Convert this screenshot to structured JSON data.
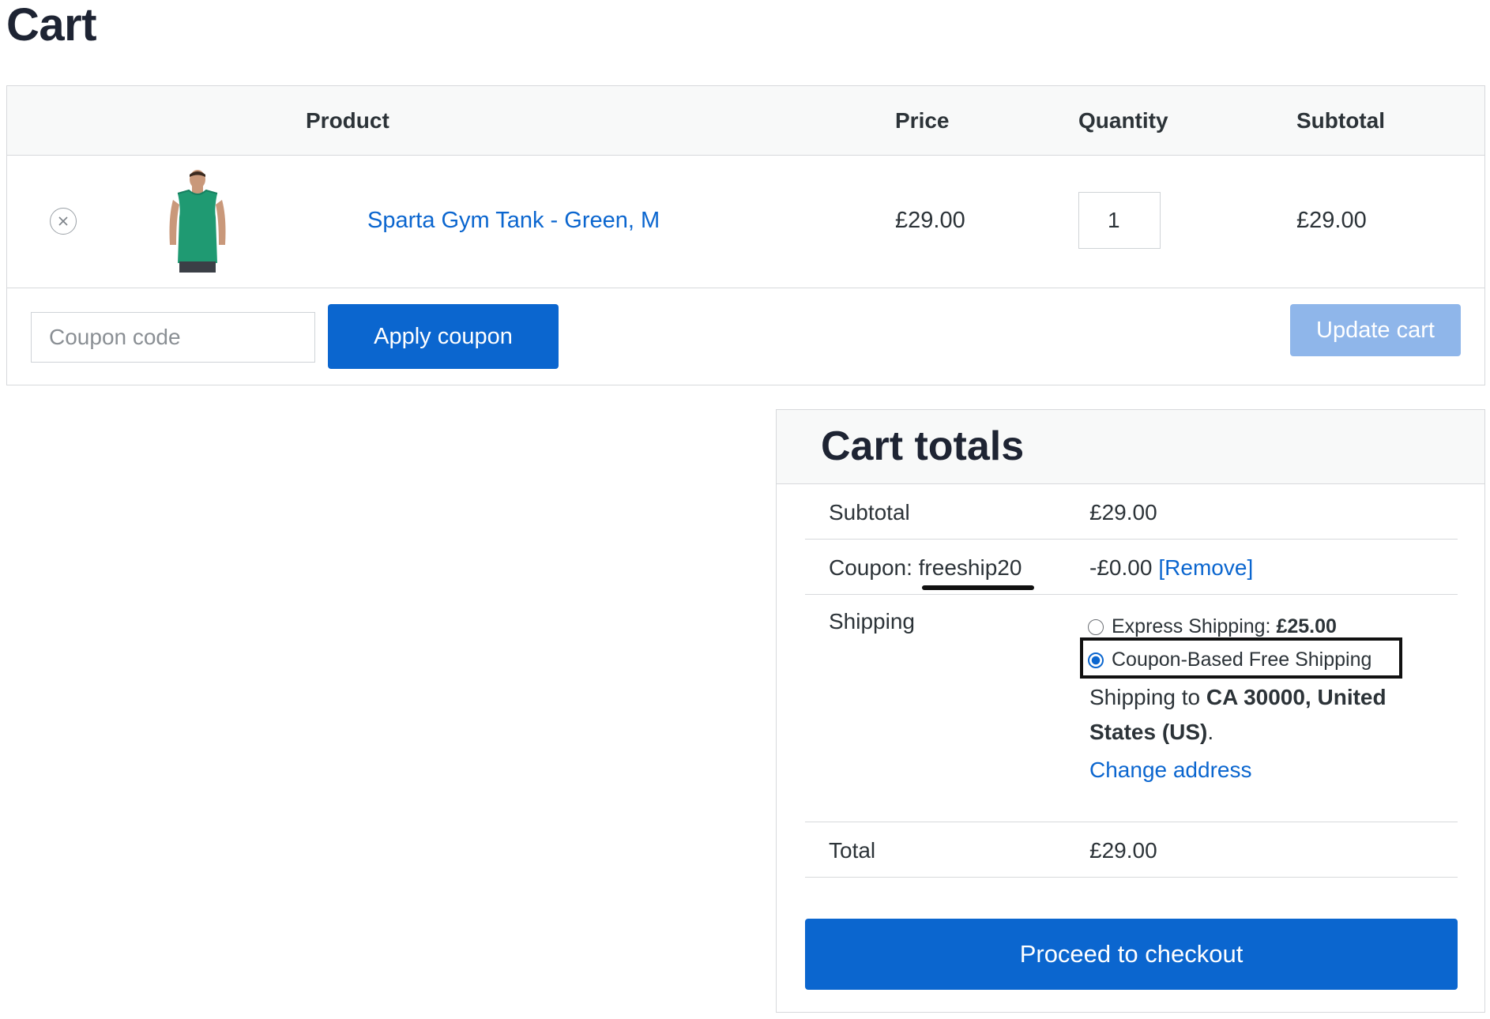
{
  "page": {
    "title": "Cart"
  },
  "cart_table": {
    "headers": {
      "product": "Product",
      "price": "Price",
      "quantity": "Quantity",
      "subtotal": "Subtotal"
    },
    "items": [
      {
        "name": "Sparta Gym Tank - Green, M",
        "price": "£29.00",
        "quantity": "1",
        "subtotal": "£29.00",
        "thumbnail_icon": "green-tank-top-thumbnail",
        "remove_icon": "close-circle-icon"
      }
    ],
    "coupon_placeholder": "Coupon code",
    "apply_coupon_label": "Apply coupon",
    "update_cart_label": "Update cart"
  },
  "cart_totals": {
    "title": "Cart totals",
    "subtotal_label": "Subtotal",
    "subtotal_value": "£29.00",
    "coupon_prefix": "Coupon:",
    "coupon_code": "freeship20",
    "coupon_value": "-£0.00",
    "coupon_remove": "[Remove]",
    "shipping_label": "Shipping",
    "shipping_options": [
      {
        "name": "Express Shipping:",
        "price": "£25.00",
        "selected": false
      },
      {
        "name": "Coupon-Based Free Shipping",
        "price": "",
        "selected": true
      }
    ],
    "shipping_to_prefix": "Shipping to",
    "shipping_destination": "CA 30000, United States (US)",
    "shipping_to_suffix": ".",
    "change_address": "Change address",
    "total_label": "Total",
    "total_value": "£29.00",
    "checkout_label": "Proceed to checkout"
  },
  "colors": {
    "accent": "#0b66cf",
    "accent_disabled": "#8fb6ea",
    "heading": "#1e2433",
    "text": "#2c3338",
    "border": "#d7d9dc",
    "header_bg": "#f8f9f9",
    "annotation": "#111111"
  }
}
